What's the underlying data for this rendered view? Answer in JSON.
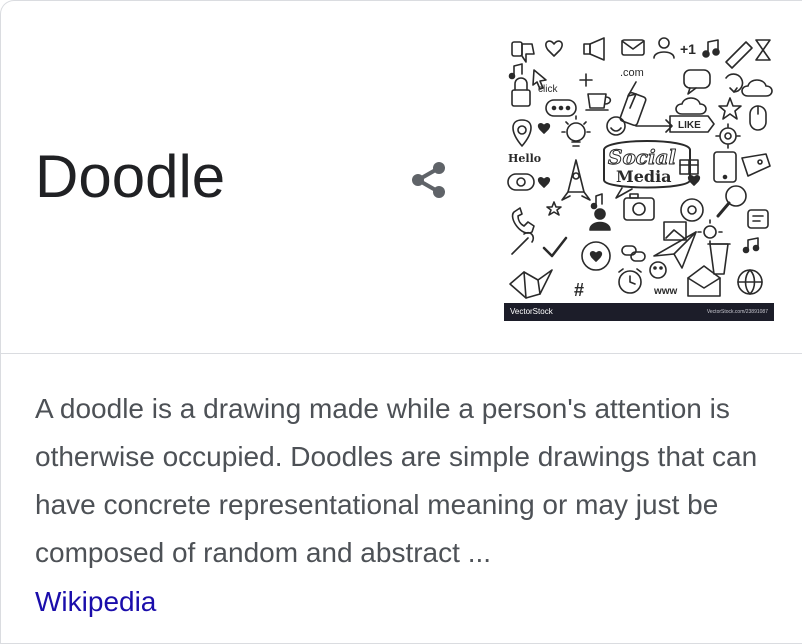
{
  "entity": {
    "title": "Doodle"
  },
  "thumbnail": {
    "watermark": "VectorStock",
    "watermark_small": "VectorStock.com/23891087",
    "doodle_texts": {
      "com": ".com",
      "plus_one": "+1",
      "click": "click",
      "like": "LIKE",
      "hello": "Hello",
      "social": "Social",
      "media": "Media",
      "www": "www",
      "hash": "#"
    }
  },
  "description": {
    "text": "A doodle is a drawing made while a person's attention is otherwise occupied. Doodles are simple drawings that can have concrete representational meaning or may just be composed of random and abstract ...",
    "source_label": "Wikipedia"
  },
  "colors": {
    "title": "#202124",
    "body_text": "#4d5156",
    "link": "#1a0dab",
    "icon": "#5f6368",
    "divider": "#dadce0"
  },
  "icons": {
    "share": "share-icon"
  }
}
